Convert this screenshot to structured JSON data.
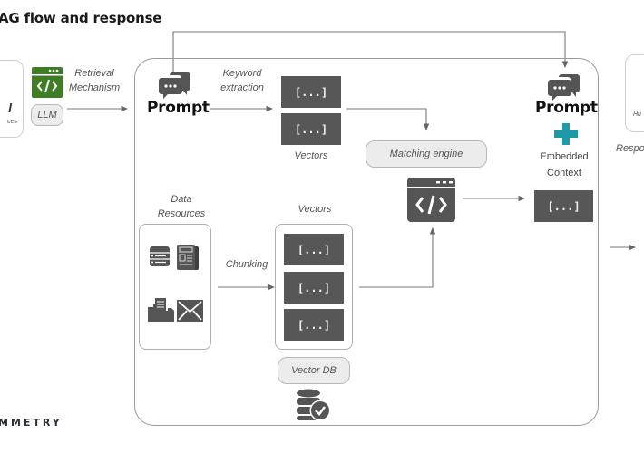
{
  "header": {
    "title": "AG flow and response",
    "brand": "MMETRY"
  },
  "left_panel": {
    "card_partial_text": "l",
    "card_partial_subtext": "ces",
    "retrieval_label_line1": "Retrieval",
    "retrieval_label_line2": "Mechanism",
    "llm_label": "LLM",
    "accent_color": "#3f7d25"
  },
  "main": {
    "prompt_in": {
      "label": "Prompt",
      "icon": "chat-bubbles-icon"
    },
    "keyword_label_line1": "Keyword",
    "keyword_label_line2": "extraction",
    "query_vectors": {
      "items": [
        "[...]",
        "[...]"
      ],
      "caption": "Vectors"
    },
    "matching_engine": {
      "label": "Matching engine",
      "icon": "code-window-icon"
    },
    "data_resources": {
      "label_line1": "Data",
      "label_line2": "Resources",
      "icons": [
        "database-list-icon",
        "newspaper-icon",
        "inbox-tray-icon",
        "envelope-icon"
      ]
    },
    "chunking_label": "Chunking",
    "doc_vectors": {
      "caption": "Vectors",
      "items": [
        "[...]",
        "[...]",
        "[...]"
      ]
    },
    "vector_db": {
      "label": "Vector DB",
      "icon": "database-check-icon"
    },
    "prompt_out": {
      "label": "Prompt",
      "icon": "chat-bubbles-icon",
      "plus_icon": "plus-icon",
      "plus_color": "#1e9aa6",
      "context_line1": "Embedded",
      "context_line2": "Context",
      "context_vector": "[...]"
    }
  },
  "right_panel": {
    "card_partial_text": "Hu",
    "response_label": "Respo"
  },
  "colors": {
    "dark_fill": "#575757",
    "line": "#777777",
    "frame": "#9a9a9a"
  }
}
